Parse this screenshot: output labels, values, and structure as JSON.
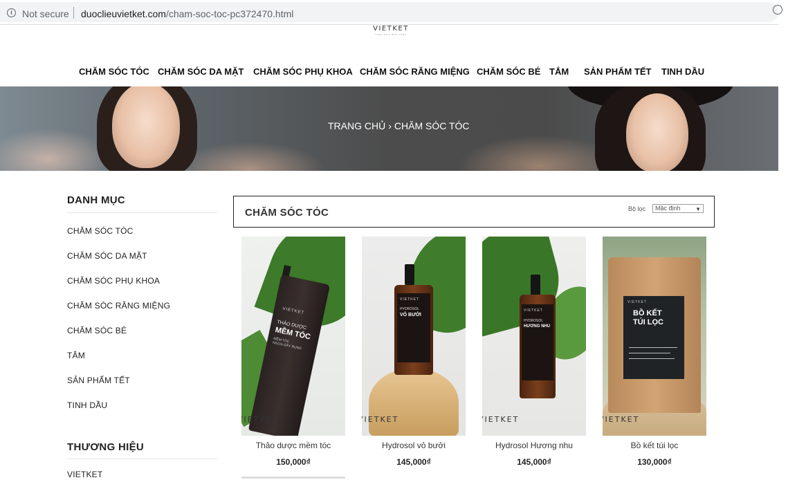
{
  "browser": {
    "security": "Not secure",
    "url_domain": "duoclieuvietket.com",
    "url_path": "/cham-soc-toc-pc372470.html"
  },
  "logo": {
    "name": "VIETKET",
    "tagline": "TINH HOA BỐT VIỆT"
  },
  "nav": [
    "CHĂM SÓC TÓC",
    "CHĂM SÓC DA MẶT",
    "CHĂM SÓC PHỤ KHOA",
    "CHĂM SÓC RĂNG MIỆNG",
    "CHĂM SÓC BÉ",
    "TẮM",
    "SẢN PHẨM TẾT",
    "TINH DẦU"
  ],
  "breadcrumb": {
    "home": "TRANG CHỦ",
    "separator": "›",
    "current": "CHĂM SÓC TÓC"
  },
  "sidebar": {
    "category_heading": "DANH MỤC",
    "categories": [
      "CHĂM SÓC TÓC",
      "CHĂM SÓC DA MẶT",
      "CHĂM SÓC PHỤ KHOA",
      "CHĂM SÓC RĂNG MIỆNG",
      "CHĂM SÓC BÉ",
      "TẮM",
      "SẢN PHẨM TẾT",
      "TINH DẦU"
    ],
    "brand_heading": "THƯƠNG HIỆU",
    "brands": [
      "VIETKET"
    ]
  },
  "category": {
    "title": "CHĂM SÓC TÓC",
    "filter_label": "Bộ lọc",
    "filter_value": "Mặc định"
  },
  "products": [
    {
      "name": "Thảo dược mềm tóc",
      "price": "150,000₫",
      "watermark": "VIETKET",
      "bottle_brand": "VIETKET",
      "bottle_line1": "THẢO DƯỢC",
      "bottle_line2": "MỀM TÓC",
      "bottle_line3": "MỀM TÓC",
      "bottle_line4": "NGỪA GÃY RỤNG"
    },
    {
      "name": "Hydrosol vỏ bưởi",
      "price": "145,000₫",
      "watermark": "VIETKET",
      "bottle_brand": "VIETKET",
      "bottle_line1": "HYDROSOL",
      "bottle_line2": "VỎ BƯỞI"
    },
    {
      "name": "Hydrosol Hương nhu",
      "price": "145,000₫",
      "watermark": "VIETKET",
      "bottle_brand": "VIETKET",
      "bottle_line1": "HYDROSOL",
      "bottle_line2": "HƯƠNG NHU"
    },
    {
      "name": "Bồ kết túi lọc",
      "price": "130,000₫",
      "watermark": "VIETKET",
      "bag_brand": "VIETKET",
      "bag_line1": "BỒ KẾT",
      "bag_line2": "TÚI LỌC"
    }
  ],
  "colors": {
    "accent": "#222222",
    "banner": "#4c4c4c",
    "leaf": "#3f7d2c",
    "amber": "#6b3a1c",
    "kraft": "#c89a6a"
  }
}
